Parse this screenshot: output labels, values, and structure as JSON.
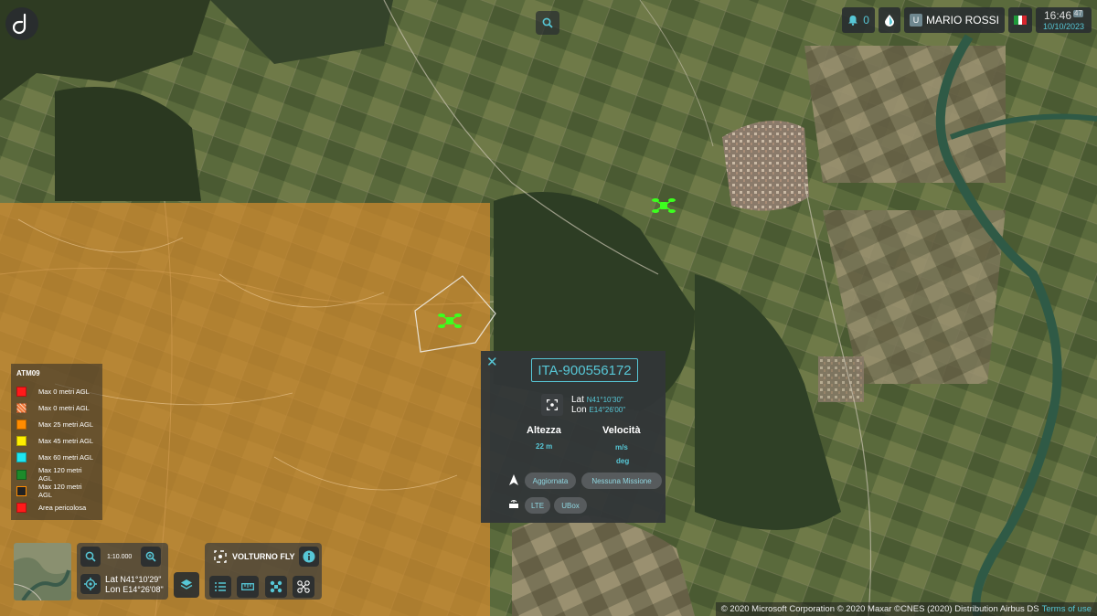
{
  "topbar": {
    "notifications_count": "0",
    "user_badge": "U",
    "user_name": "MARIO ROSSI",
    "time": "16:46",
    "seconds": "47",
    "date": "10/10/2023"
  },
  "legend": {
    "title": "ATM09",
    "items": [
      {
        "label": "Max 0 metri AGL",
        "color": "#ff1a1a"
      },
      {
        "label": "Max 0 metri AGL",
        "color": "#f07a3a",
        "hatched": true
      },
      {
        "label": "Max 25 metri AGL",
        "color": "#ff8c00"
      },
      {
        "label": "Max 45 metri AGL",
        "color": "#ffee00"
      },
      {
        "label": "Max 60 metri AGL",
        "color": "#1ee6f0"
      },
      {
        "label": "Max 120 metri AGL",
        "color": "#1c8a2a"
      },
      {
        "label": "Max 120 metri AGL",
        "color": "#222222",
        "outlined": true
      },
      {
        "label": "Area pericolosa",
        "color": "#ff1a1a"
      }
    ]
  },
  "map_controls": {
    "scale": "1:10.000",
    "lat_label": "Lat",
    "lat_value": "N41°10'29\"",
    "lon_label": "Lon",
    "lon_value": "E14°26'08\"",
    "fleet_title": "VOLTURNO FLY"
  },
  "popup": {
    "drone_id": "ITA-900556172",
    "lat_label": "Lat",
    "lat_value": "N41°10'30\"",
    "lon_label": "Lon",
    "lon_value": "E14°26'00\"",
    "altitude_label": "Altezza",
    "altitude_value": "22 m",
    "speed_label": "Velocità",
    "speed_unit": "m/s",
    "heading_unit": "deg",
    "status_pill": "Aggiornata",
    "mission_pill": "Nessuna Missione",
    "network_pill": "LTE",
    "device_pill": "UBox"
  },
  "attribution": {
    "text": "© 2020 Microsoft Corporation © 2020 Maxar ©CNES (2020) Distribution Airbus DS",
    "link": "Terms of use"
  },
  "colors": {
    "accent": "#57c7d6",
    "restricted_zone": "#d38a2e",
    "drone": "#3cff1e"
  }
}
